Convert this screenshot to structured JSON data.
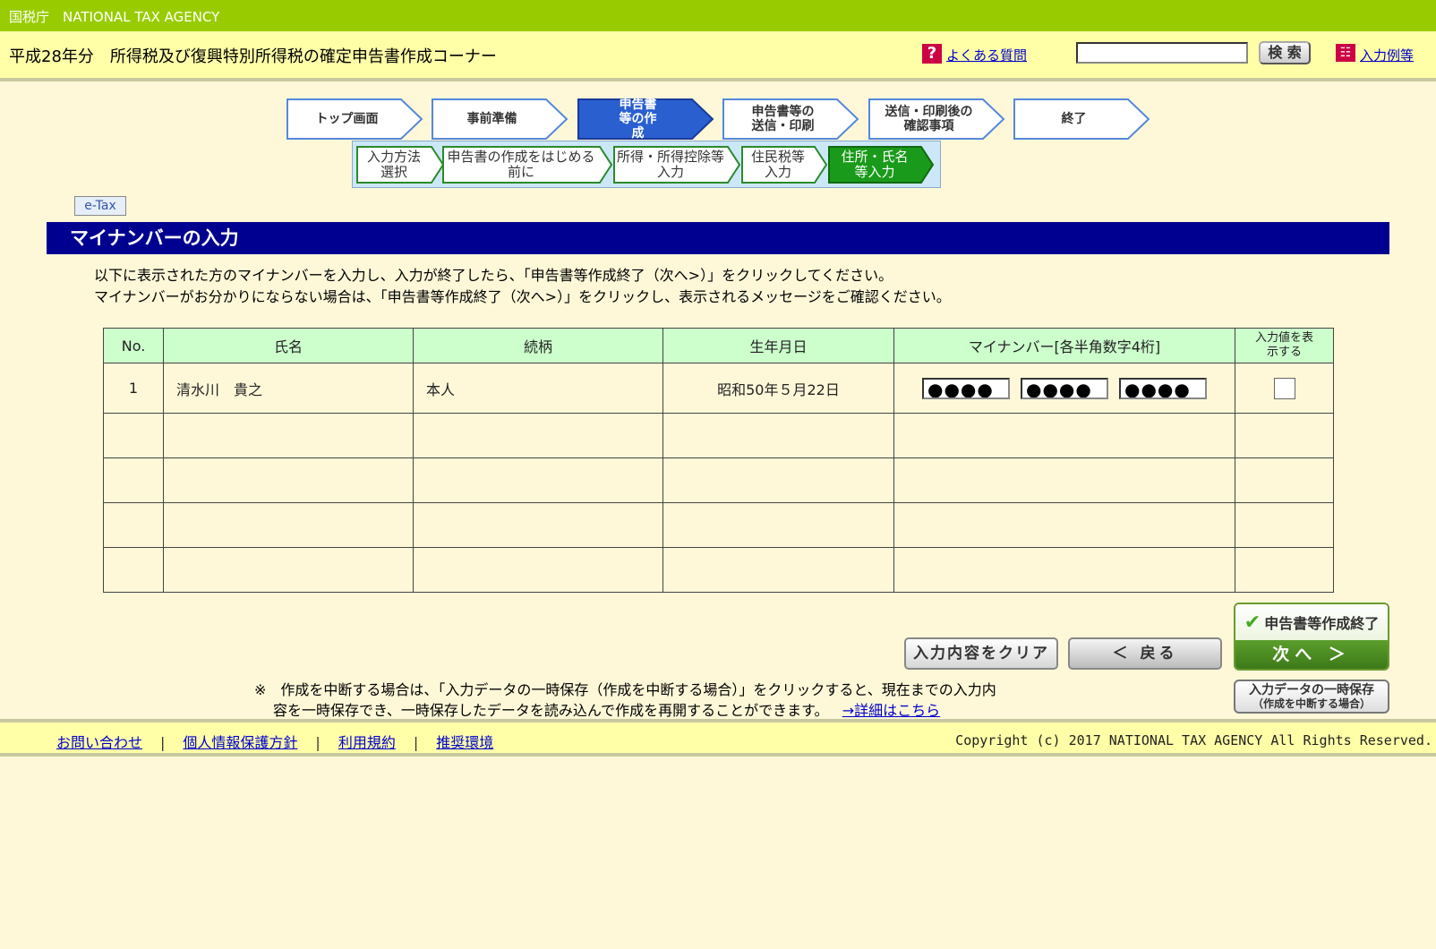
{
  "agency": "国税庁　NATIONAL TAX AGENCY",
  "header": {
    "title": "平成28年分　所得税及び復興特別所得税の確定申告書作成コーナー",
    "faq_label": "よくある質問",
    "search_label": "検 索",
    "example_label": "入力例等"
  },
  "steps": [
    "トップ画面",
    "事前準備",
    "申告書等の作成",
    "申告書等の送信・印刷",
    "送信・印刷後の確認事項",
    "終了"
  ],
  "substeps": [
    "入力方法選択",
    "申告書の作成をはじめる前に",
    "所得・所得控除等入力",
    "住民税等入力",
    "住所・氏名等入力"
  ],
  "etax_label": "e-Tax",
  "section_title": "マイナンバーの入力",
  "instructions": [
    "以下に表示された方のマイナンバーを入力し、入力が終了したら、「申告書等作成終了（次へ>）」をクリックしてください。",
    "マイナンバーがお分かりにならない場合は、「申告書等作成終了（次へ>）」をクリックし、表示されるメッセージをご確認ください。"
  ],
  "table": {
    "headers": [
      "No.",
      "氏名",
      "続柄",
      "生年月日",
      "マイナンバー[各半角数字4桁]",
      "入力値を表示する"
    ],
    "rows": [
      {
        "no": "1",
        "name": "清水川　貴之",
        "relation": "本人",
        "birth": "昭和50年５月22日",
        "mynumber": [
          "●●●●",
          "●●●●",
          "●●●●"
        ]
      }
    ]
  },
  "buttons": {
    "clear": "入力内容をクリア",
    "back": "＜ 戻る",
    "finish_top": "申告書等作成終了",
    "finish_bottom": "次へ ＞",
    "save_line1": "入力データの一時保存",
    "save_line2": "（作成を中断する場合）"
  },
  "note": {
    "line1": "※　作成を中断する場合は、「入力データの一時保存（作成を中断する場合）」をクリックすると、現在までの入力内",
    "line2": "容を一時保存でき、一時保存したデータを読み込んで作成を再開することができます。",
    "detail_link": "→詳細はこちら"
  },
  "footer": {
    "links": [
      "お問い合わせ",
      "個人情報保護方針",
      "利用規約",
      "推奨環境"
    ],
    "separator": "|",
    "copyright": "Copyright (c) 2017 NATIONAL TAX AGENCY All Rights Reserved."
  },
  "colors": {
    "topbar": "#99cc00",
    "header_bg": "#ffffa8",
    "section_bar": "#000090",
    "active_step": "#2a5fd0",
    "active_substep": "#1a9a1a",
    "table_header": "#ccffcc"
  }
}
